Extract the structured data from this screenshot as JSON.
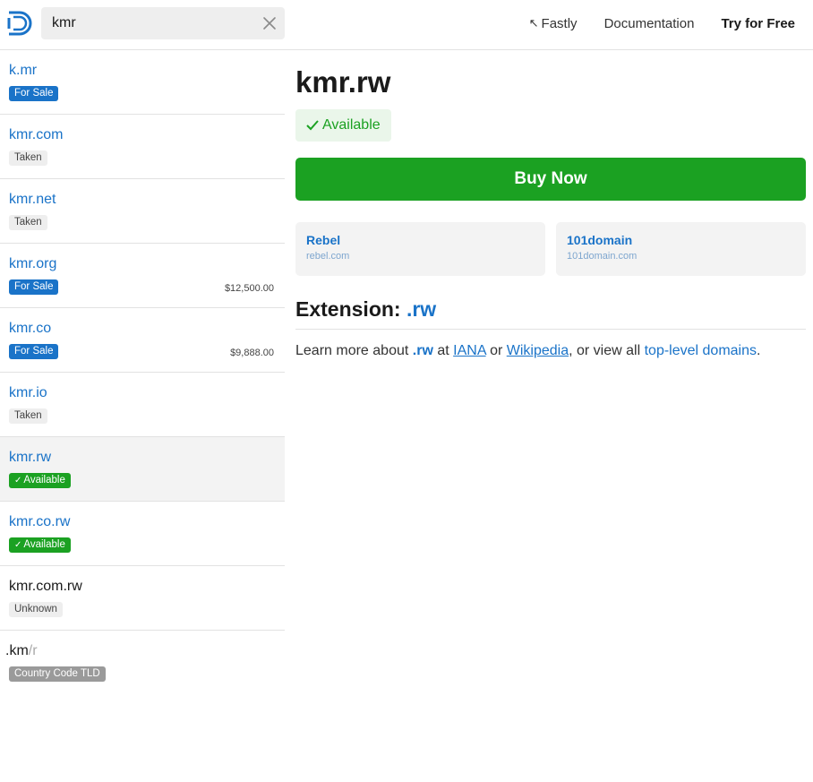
{
  "header": {
    "search_value": "kmr",
    "nav": {
      "fastly_label": "Fastly",
      "documentation_label": "Documentation",
      "try_label": "Try for Free"
    }
  },
  "sidebar": {
    "items": [
      {
        "name": "k.mr",
        "status": "For Sale",
        "price": ""
      },
      {
        "name": "kmr.com",
        "status": "Taken",
        "price": ""
      },
      {
        "name": "kmr.net",
        "status": "Taken",
        "price": ""
      },
      {
        "name": "kmr.org",
        "status": "For Sale",
        "price": "$12,500.00"
      },
      {
        "name": "kmr.co",
        "status": "For Sale",
        "price": "$9,888.00"
      },
      {
        "name": "kmr.io",
        "status": "Taken",
        "price": ""
      },
      {
        "name": "kmr.rw",
        "status": "Available",
        "price": ""
      },
      {
        "name": "kmr.co.rw",
        "status": "Available",
        "price": ""
      },
      {
        "name": "kmr.com.rw",
        "status": "Unknown",
        "price": ""
      }
    ],
    "tld_row": {
      "name_main": ".km",
      "name_suffix": "/r",
      "badge": "Country Code TLD"
    }
  },
  "main": {
    "domain": "kmr.rw",
    "status": "Available",
    "buy_label": "Buy Now",
    "registrars": [
      {
        "name": "Rebel",
        "url": "rebel.com"
      },
      {
        "name": "101domain",
        "url": "101domain.com"
      }
    ],
    "extension_label": "Extension:",
    "extension": ".rw",
    "learn": {
      "prefix": "Learn more about",
      "ext": ".rw",
      "at": "at",
      "iana": "IANA",
      "or": "or",
      "wikipedia": "Wikipedia",
      "view_all": ", or view all",
      "tld_link": "top-level domains",
      "end": "."
    }
  },
  "colors": {
    "link_blue": "#1a73c8",
    "available_green": "#1ba122",
    "for_sale_blue": "#1a73c8",
    "taken_gray": "#eeeeee"
  },
  "icons": [
    "logo-icon",
    "clear-icon",
    "fastly-arrow-icon",
    "check-icon"
  ]
}
